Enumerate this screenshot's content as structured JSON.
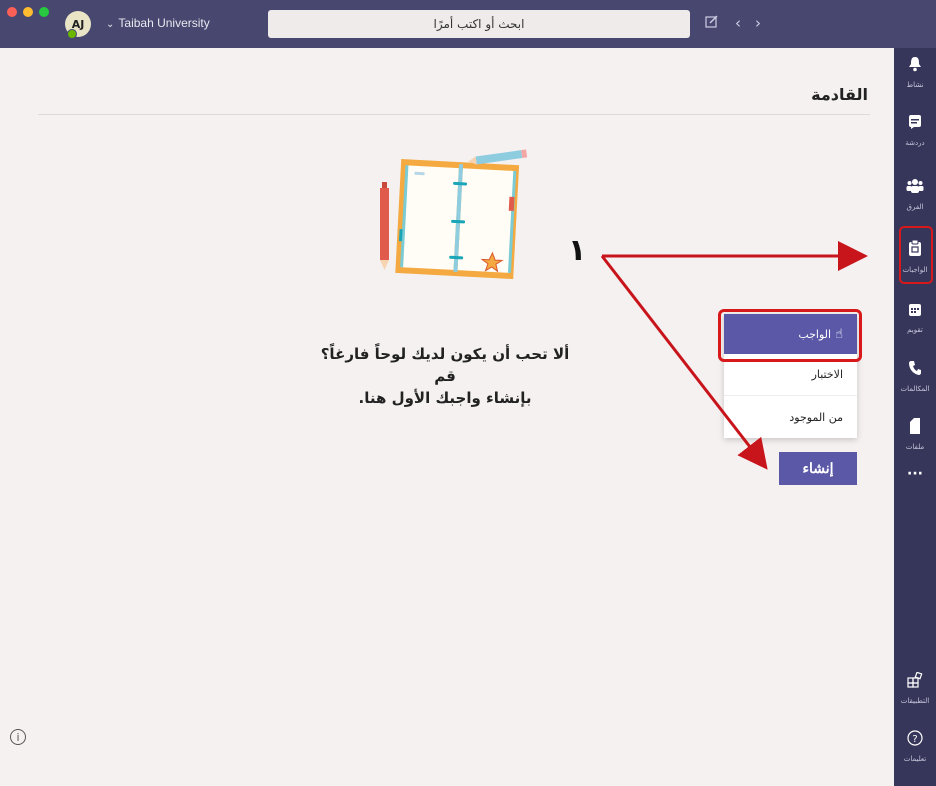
{
  "titlebar": {
    "avatar_initials": "AJ",
    "org_name": "Taibah University",
    "search_placeholder": "ابحث أو اكتب أمرًا"
  },
  "rail": {
    "items": [
      {
        "label": "نشاط",
        "icon": "bell-icon"
      },
      {
        "label": "دردشة",
        "icon": "chat-icon"
      },
      {
        "label": "الفرق",
        "icon": "teams-icon"
      },
      {
        "label": "الواجبات",
        "icon": "assignments-icon",
        "active": true
      },
      {
        "label": "تقويم",
        "icon": "calendar-icon"
      },
      {
        "label": "المكالمات",
        "icon": "phone-icon"
      },
      {
        "label": "ملفات",
        "icon": "file-icon"
      },
      {
        "label": "",
        "icon": "more-icon"
      }
    ],
    "bottom_items": [
      {
        "label": "التطبيقات",
        "icon": "apps-icon"
      },
      {
        "label": "تعليمات",
        "icon": "help-icon"
      }
    ]
  },
  "main": {
    "title": "القادمة",
    "empty_message_line1": "ألا تحب أن يكون لديك لوحاً فارغاً؟ قم",
    "empty_message_line2": "بإنشاء واجبك الأول هنا."
  },
  "create_menu": {
    "items": [
      "الواجب",
      "الاختبار",
      "من الموجود"
    ],
    "button_label": "إنشاء"
  },
  "annotation": {
    "number": "١"
  },
  "colors": {
    "titlebar": "#47476f",
    "rail": "#36355a",
    "accent": "#5b59a7",
    "highlight": "#d7191c",
    "background": "#f5f1f1"
  }
}
